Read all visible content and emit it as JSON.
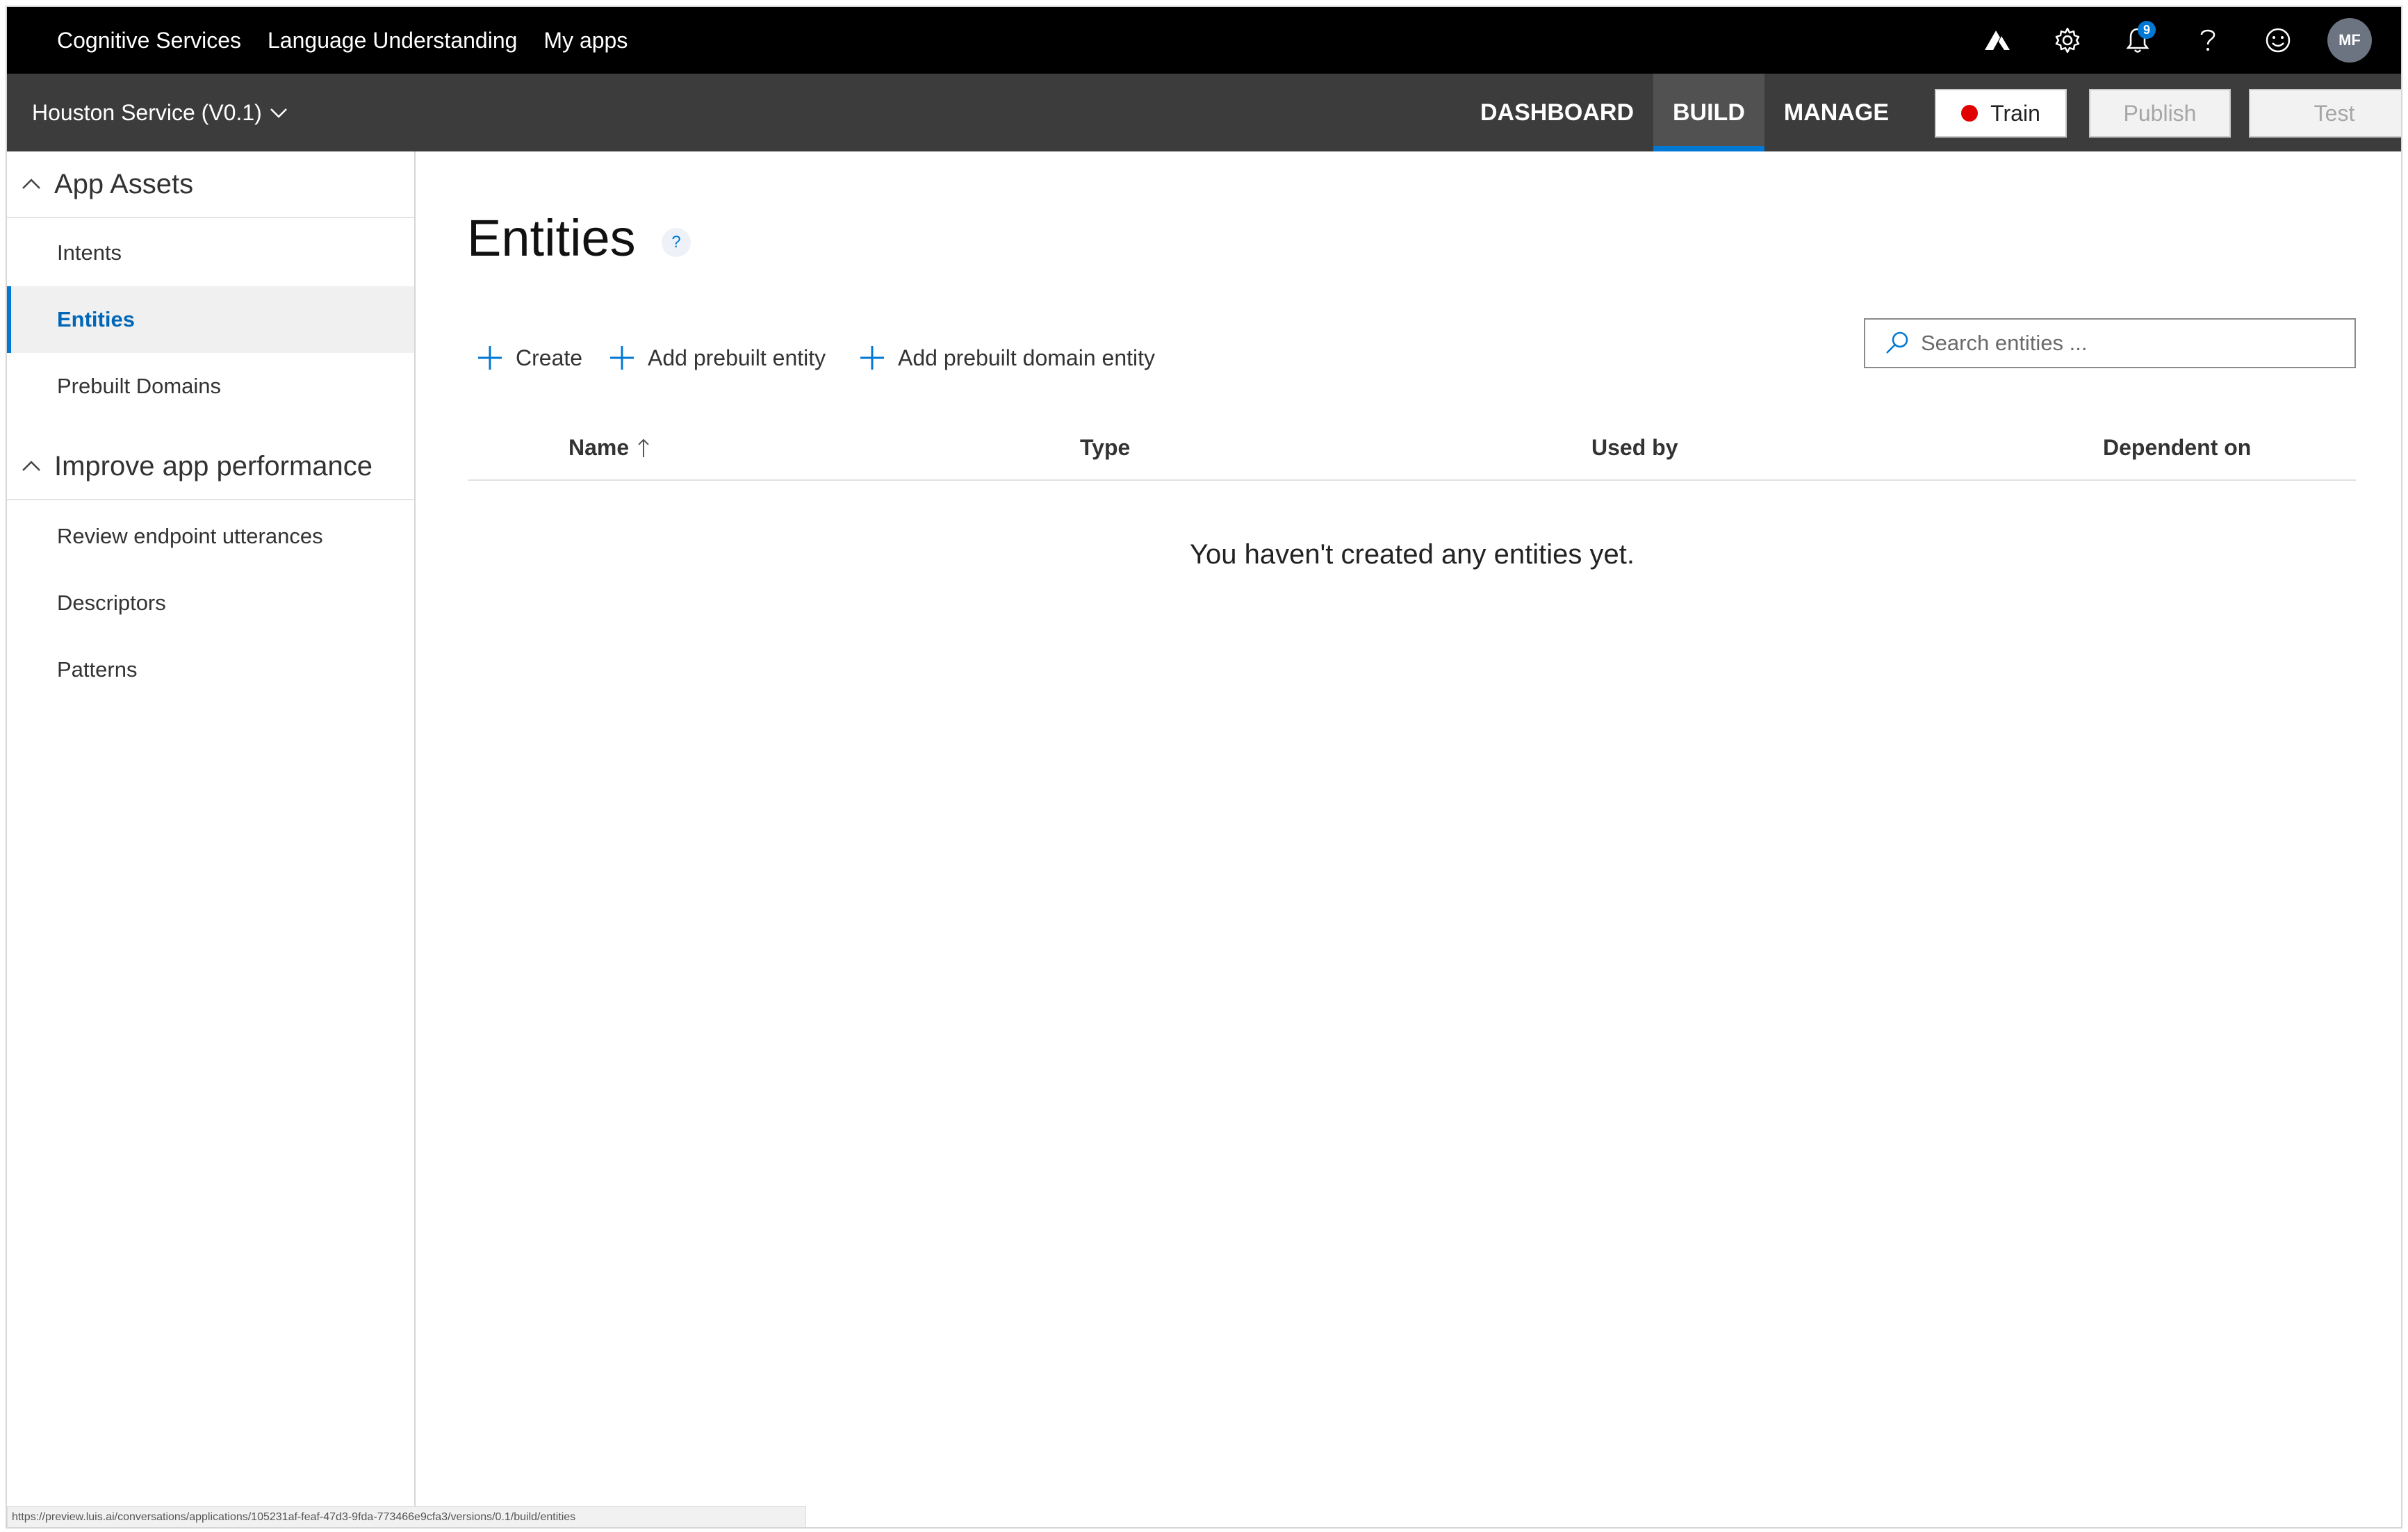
{
  "topbar": {
    "links": [
      "Cognitive Services",
      "Language Understanding",
      "My apps"
    ],
    "notification_count": "9",
    "avatar_initials": "MF",
    "icons": [
      "azure-icon",
      "gear-icon",
      "bell-icon",
      "help-icon",
      "smiley-icon"
    ]
  },
  "subbar": {
    "app_name": "Houston Service (V0.1)",
    "tabs": [
      "DASHBOARD",
      "BUILD",
      "MANAGE"
    ],
    "active_tab": "BUILD",
    "train_label": "Train",
    "publish_label": "Publish",
    "test_label": "Test",
    "train_status_color": "#e00000"
  },
  "sidebar": {
    "sections": [
      {
        "title": "App Assets",
        "items": [
          "Intents",
          "Entities",
          "Prebuilt Domains"
        ]
      },
      {
        "title": "Improve app performance",
        "items": [
          "Review endpoint utterances",
          "Descriptors",
          "Patterns"
        ]
      }
    ],
    "active_item": "Entities"
  },
  "main": {
    "title": "Entities",
    "help": "?",
    "commands": [
      "Create",
      "Add prebuilt entity",
      "Add prebuilt domain entity"
    ],
    "search_placeholder": "Search entities ...",
    "columns": [
      "Name",
      "Type",
      "Used by",
      "Dependent on"
    ],
    "empty_message": "You haven't created any entities yet."
  },
  "status_url": "https://preview.luis.ai/conversations/applications/105231af-feaf-47d3-9fda-773466e9cfa3/versions/0.1/build/entities",
  "colors": {
    "accent": "#0078d4",
    "topbar": "#000000",
    "subbar": "#3c3c3c"
  }
}
